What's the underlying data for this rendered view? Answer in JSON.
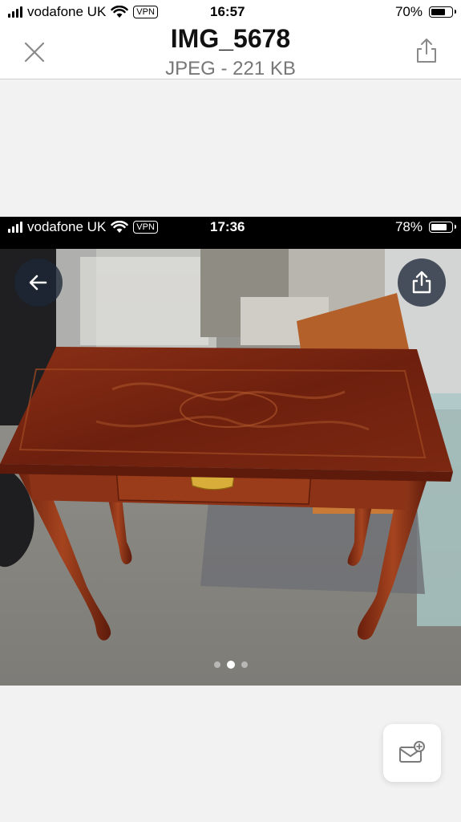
{
  "status_bar": {
    "carrier": "vodafone UK",
    "vpn": "VPN",
    "time": "16:57",
    "battery": "70%",
    "battery_level": 0.7
  },
  "viewer": {
    "title": "IMG_5678",
    "subtitle": "JPEG - 221 KB"
  },
  "photo": {
    "status_bar": {
      "carrier": "vodafone UK",
      "vpn": "VPN",
      "time": "17:36",
      "battery": "78%",
      "battery_level": 0.78
    },
    "page_count": 3,
    "current_page": 2
  },
  "icons": {
    "close": "close-icon",
    "share": "share-icon",
    "back": "arrow-left-icon",
    "photo_share": "share-icon",
    "compose": "mail-add-icon"
  },
  "colors": {
    "wood": "#7a2a14",
    "accent": "#1e2837"
  }
}
